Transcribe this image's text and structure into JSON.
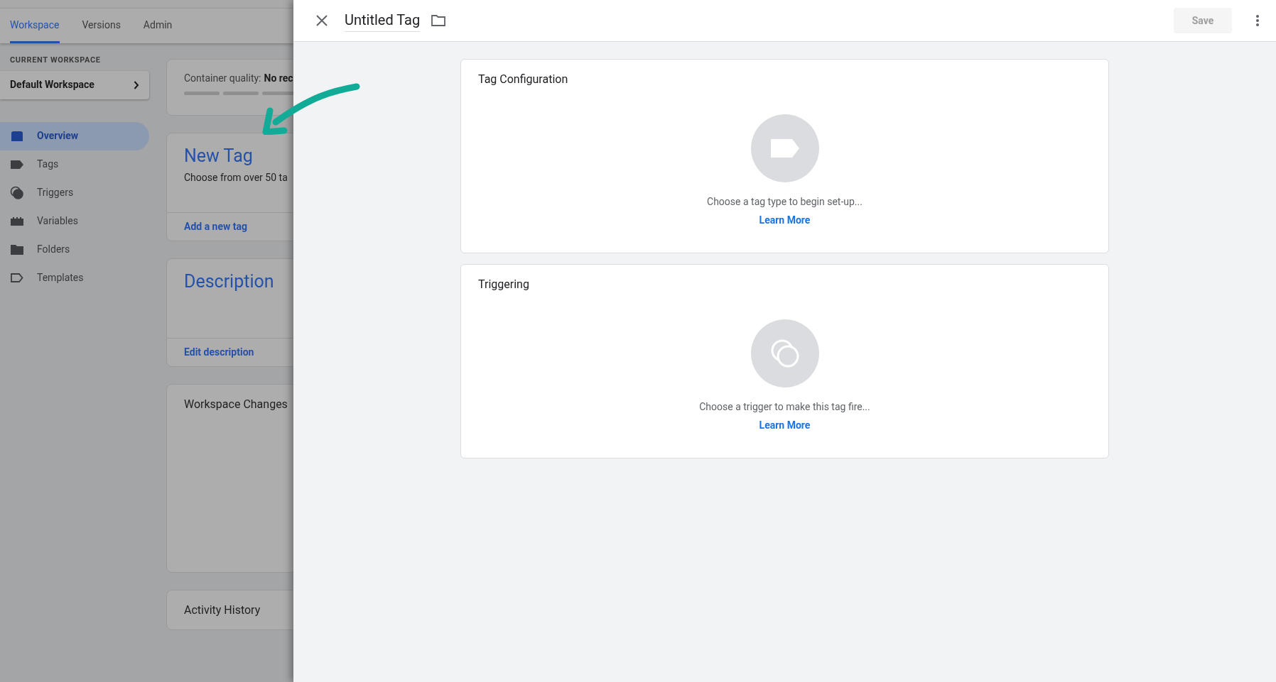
{
  "top_tabs": [
    {
      "label": "Workspace",
      "selected": true
    },
    {
      "label": "Versions",
      "selected": false
    },
    {
      "label": "Admin",
      "selected": false
    }
  ],
  "workspace": {
    "heading": "CURRENT WORKSPACE",
    "name": "Default Workspace"
  },
  "nav": [
    {
      "label": "Overview",
      "kind": "overview",
      "selected": true
    },
    {
      "label": "Tags",
      "kind": "tag",
      "selected": false
    },
    {
      "label": "Triggers",
      "kind": "trigger",
      "selected": false
    },
    {
      "label": "Variables",
      "kind": "variable",
      "selected": false
    },
    {
      "label": "Folders",
      "kind": "folder",
      "selected": false
    },
    {
      "label": "Templates",
      "kind": "template",
      "selected": false
    }
  ],
  "cards": [
    {
      "kind": "quality",
      "label": "Container quality:",
      "value": "No rec"
    },
    {
      "kind": "action",
      "title": "New Tag",
      "text": "Choose from over 50 ta",
      "link": "Add a new tag"
    },
    {
      "kind": "action",
      "title": "Description",
      "link": "Edit description"
    },
    {
      "kind": "tall",
      "title": "Workspace Changes"
    },
    {
      "kind": "plain",
      "title": "Activity History"
    }
  ],
  "drawer": {
    "title": "Untitled Tag",
    "save": {
      "label": "Save",
      "disabled": true
    },
    "sections": [
      {
        "title": "Tag Configuration",
        "kind": "tag",
        "text": "Choose a tag type to begin set-up...",
        "link": "Learn More"
      },
      {
        "title": "Triggering",
        "kind": "trigger",
        "text": "Choose a trigger to make this tag fire...",
        "link": "Learn More"
      }
    ]
  }
}
